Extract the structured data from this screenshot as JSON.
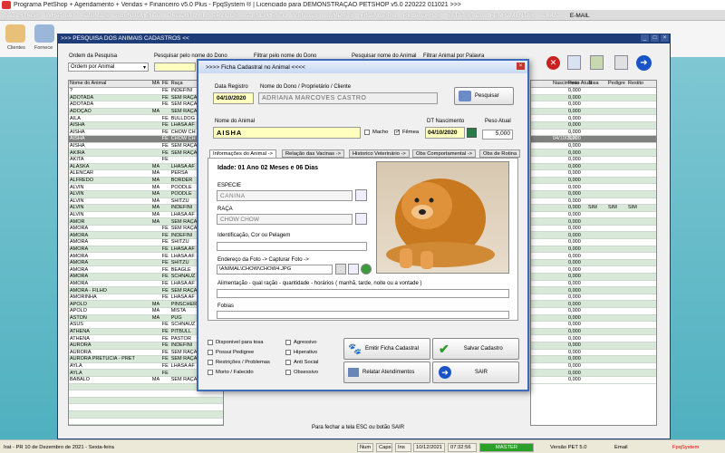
{
  "app": {
    "title": "Programa PetShop + Agendamento + Vendas + Financeiro v5.0 Plus - FpqSystem ® | Licenciado para  DEMONSTRAÇÃO PETSHOP v5.0 220222 011021 >>>",
    "menu": [
      "CADASTROS",
      "WHATSAPP",
      "ANIMAIS",
      "AGENDAMENTO",
      "PRODUTOS E SERVIÇOS",
      "ATENDIMENTO",
      "VENDAS",
      "COMPRAS",
      "FINANCEIRO",
      "RELATÓRIOS",
      "ESTATÍSTICA",
      "FERRAMENTAS",
      "AJUDA"
    ],
    "menu_email": "E-MAIL",
    "toolbar_labels": {
      "clientes": "Clientes",
      "fornece": "Fornece"
    }
  },
  "search_window": {
    "title": ">>> PESQUISA DOS ANIMAIS CADASTROS <<",
    "order_label": "Ordem da Pesquisa",
    "order_value": "Ordem por Animal",
    "filter_owner_label": "Pesquisar pelo nome do Dono",
    "filter_owner2_label": "Filtrar pelo nome do Dono",
    "search_owner_label": "Pesquisar nome do Animal",
    "filter_word_label": "Filtrar Animal por Palavra",
    "columns": [
      "Nome do Animal",
      "MA",
      "FE",
      "Raça"
    ],
    "rows": [
      [
        "?",
        "",
        "FE",
        "INDEFINI"
      ],
      [
        "ADOTADA",
        "",
        "FE",
        "SEM RAÇA"
      ],
      [
        "ADOTADA",
        "",
        "FE",
        "SEM RAÇA"
      ],
      [
        "ADOÇÃO",
        "MA",
        "",
        "SEM RAÇA"
      ],
      [
        "AILA",
        "",
        "FE",
        "BULLDOG"
      ],
      [
        "AISHA",
        "",
        "FE",
        "LHASA AF"
      ],
      [
        "AISHA",
        "",
        "FE",
        "CHOW CH"
      ],
      [
        "AISHA",
        "",
        "FE",
        "CHOW CH"
      ],
      [
        "AISHA",
        "",
        "FE",
        "SEM RAÇA"
      ],
      [
        "AKIRA",
        "",
        "FE",
        "SEM RAÇA"
      ],
      [
        "AKITA",
        "",
        "FE",
        ""
      ],
      [
        "ALASKA",
        "MA",
        "",
        "LHASA AF"
      ],
      [
        "ALENCAR",
        "MA",
        "",
        "PERSA"
      ],
      [
        "ALFREDO",
        "MA",
        "",
        "BORDER"
      ],
      [
        "ALVIN",
        "MA",
        "",
        "POODLE"
      ],
      [
        "ALVIN",
        "MA",
        "",
        "POODLE"
      ],
      [
        "ALVIN",
        "MA",
        "",
        "SHITZU"
      ],
      [
        "ALVIN",
        "MA",
        "",
        "INDEFINI"
      ],
      [
        "ALVIN",
        "MA",
        "",
        "LHASA AF"
      ],
      [
        "AMOR",
        "MA",
        "",
        "SEM RAÇA"
      ],
      [
        "AMORA",
        "",
        "FE",
        "SEM RAÇA"
      ],
      [
        "AMORA",
        "",
        "FE",
        "INDEFINI"
      ],
      [
        "AMORA",
        "",
        "FE",
        "SHITZU"
      ],
      [
        "AMORA",
        "",
        "FE",
        "LHASA AF"
      ],
      [
        "AMORA",
        "",
        "FE",
        "LHASA AF"
      ],
      [
        "AMORA",
        "",
        "FE",
        "SHITZU"
      ],
      [
        "AMORA",
        "",
        "FE",
        "BEAGLE"
      ],
      [
        "AMORA",
        "",
        "FE",
        "SCHNAUZ"
      ],
      [
        "AMORA",
        "",
        "FE",
        "LHASA AF"
      ],
      [
        "AMORA - FILHO",
        "",
        "FE",
        "SEM RAÇA"
      ],
      [
        "AMORINHA",
        "",
        "FE",
        "LHASA AF"
      ],
      [
        "APOLO",
        "MA",
        "",
        "PINSCHER"
      ],
      [
        "APOLO",
        "MA",
        "",
        "MISTA"
      ],
      [
        "ASTON",
        "MA",
        "",
        "PUG"
      ],
      [
        "ASUS",
        "",
        "FE",
        "SCHNAUZ"
      ],
      [
        "ATHENA",
        "",
        "FE",
        "PITBULL"
      ],
      [
        "ATHENA",
        "",
        "FE",
        "PASTOR"
      ],
      [
        "AURORA",
        "",
        "FE",
        "INDEFINI"
      ],
      [
        "AURORA",
        "",
        "FE",
        "SEM RAÇA"
      ],
      [
        "AURORA PRETUCIA - PRET",
        "",
        "FE",
        "SEM RAÇA"
      ],
      [
        "AYLA",
        "",
        "FE",
        "LHASA AF"
      ],
      [
        "AYLA",
        "",
        "FE",
        ""
      ],
      [
        "BABALO",
        "MA",
        "",
        "SEM RAÇA"
      ],
      [
        "",
        "",
        "",
        ""
      ],
      [
        "",
        "",
        "",
        ""
      ],
      [
        "",
        "",
        "",
        ""
      ],
      [
        "",
        "",
        "",
        ""
      ],
      [
        "",
        "",
        "",
        ""
      ],
      [
        "",
        "",
        "",
        ""
      ]
    ],
    "selected_row": 7,
    "right_columns": [
      "Nascimento",
      "Peso Atual",
      "Tosa",
      "Pedigre",
      "Restito"
    ],
    "right_rows": [
      [
        "",
        "0,000",
        "",
        "",
        ""
      ],
      [
        "",
        "0,000",
        "",
        "",
        ""
      ],
      [
        "",
        "0,000",
        "",
        "",
        ""
      ],
      [
        "",
        "0,000",
        "",
        "",
        ""
      ],
      [
        "",
        "0,000",
        "",
        "",
        ""
      ],
      [
        "",
        "0,000",
        "",
        "",
        ""
      ],
      [
        "",
        "0,000",
        "",
        "",
        ""
      ],
      [
        "04/10/2020",
        "5,000",
        "",
        "",
        ""
      ],
      [
        "",
        "0,000",
        "",
        "",
        ""
      ],
      [
        "",
        "0,000",
        "",
        "",
        ""
      ],
      [
        "",
        "0,000",
        "",
        "",
        ""
      ],
      [
        "",
        "0,000",
        "",
        "",
        ""
      ],
      [
        "",
        "0,000",
        "",
        "",
        ""
      ],
      [
        "",
        "0,000",
        "",
        "",
        ""
      ],
      [
        "",
        "0,000",
        "",
        "",
        ""
      ],
      [
        "",
        "0,000",
        "",
        "",
        ""
      ],
      [
        "",
        "0,000",
        "",
        "",
        ""
      ],
      [
        "",
        "0,000",
        "SIM",
        "SIM",
        "SIM"
      ],
      [
        "",
        "0,000",
        "",
        "",
        ""
      ],
      [
        "",
        "0,000",
        "",
        "",
        ""
      ],
      [
        "",
        "0,000",
        "",
        "",
        ""
      ],
      [
        "",
        "0,000",
        "",
        "",
        ""
      ],
      [
        "",
        "0,000",
        "",
        "",
        ""
      ],
      [
        "",
        "0,000",
        "",
        "",
        ""
      ],
      [
        "",
        "0,000",
        "",
        "",
        ""
      ],
      [
        "",
        "0,000",
        "",
        "",
        ""
      ],
      [
        "",
        "0,000",
        "",
        "",
        ""
      ],
      [
        "",
        "0,000",
        "",
        "",
        ""
      ],
      [
        "",
        "0,000",
        "",
        "",
        ""
      ],
      [
        "",
        "0,000",
        "",
        "",
        ""
      ],
      [
        "",
        "0,000",
        "",
        "",
        ""
      ],
      [
        "",
        "0,000",
        "",
        "",
        ""
      ],
      [
        "",
        "0,000",
        "",
        "",
        ""
      ],
      [
        "",
        "0,000",
        "",
        "",
        ""
      ],
      [
        "",
        "0,000",
        "",
        "",
        ""
      ],
      [
        "",
        "0,000",
        "",
        "",
        ""
      ],
      [
        "",
        "0,000",
        "",
        "",
        ""
      ],
      [
        "",
        "0,000",
        "",
        "",
        ""
      ],
      [
        "",
        "0,000",
        "",
        "",
        ""
      ],
      [
        "",
        "0,000",
        "",
        "",
        ""
      ],
      [
        "",
        "0,000",
        "",
        "",
        ""
      ],
      [
        "",
        "0,000",
        "",
        "",
        ""
      ],
      [
        "",
        "0,000",
        "",
        "",
        ""
      ]
    ],
    "footer_hint": "Para fechar a tela ESC ou botão SAIR"
  },
  "dialog": {
    "title": ">>>>  Ficha Cadastral no Animal  <<<<",
    "data_registro_label": "Data Registro",
    "data_registro": "04/10/2020",
    "owner_label": "Nome do Dono / Proprietário / Cliente",
    "owner": "ADRIANA MARCOVES CASTRO",
    "pesquisar": "Pesquisar",
    "animal_label": "Nome do Animal",
    "animal": "AISHA",
    "macho": "Macho",
    "femea": "Fêmea",
    "dt_nasc_label": "DT Nascimento",
    "dt_nasc": "04/10/2020",
    "peso_label": "Peso Atual",
    "peso": "5,000",
    "tabs": [
      "Informações do Animal ->",
      "Relação das Vacinas ->",
      "Historico Veterinário ->",
      "Obs Comportamental ->",
      "Obs de Rotina"
    ],
    "idade": "Idade: 01 Ano 02 Meses e 06 Dias",
    "especie_label": "ESPECIE",
    "especie": "CANINA",
    "raca_label": "RAÇA",
    "raca": "CHOW CHOW",
    "ident_label": "Identificação, Cor ou Pelagem",
    "foto_label": "Endereço da Foto ->  Capturar Foto ->",
    "foto_path": "\\ANIMAL\\CHOW\\CHOW4.JPG",
    "alimentacao_label": "Alimentação - qual ração - quantidade - horários ( manhã, tarde, noite ou a vontade )",
    "fobias_label": "Fobias",
    "checks_left": [
      "Disponivel para tosa",
      "Possui Pedigree",
      "Restrições / Problemas",
      "Morto / Falecido"
    ],
    "checks_right": [
      "Agressivo",
      "Hiperativo",
      "Anti Social",
      "Obsessivo"
    ],
    "btn_emitir": "Emitir Ficha Cadastral",
    "btn_salvar": "Salvar Cadastro",
    "btn_relatar": "Relatar Atendimentos",
    "btn_sair": "SAIR"
  },
  "status": {
    "location": "Irat - PR 10 de Dezembro de 2021 - Sexta-feira",
    "num": "Num",
    "caps": "Caps",
    "ins": "Ins",
    "date": "10/12/2021",
    "time": "07:32:56",
    "master": "MASTER",
    "version": "Versão PET 5.0",
    "email": "Email",
    "brand": "FpqSystem"
  },
  "colors": {
    "accent": "#1e3c78",
    "row_alt": "#d9e9d9",
    "highlight": "#ffffc0"
  }
}
